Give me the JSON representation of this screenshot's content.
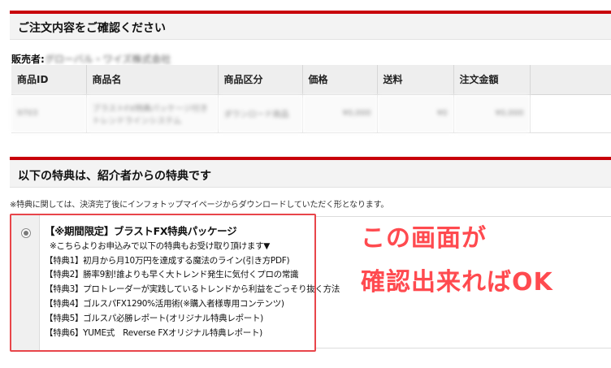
{
  "section1": {
    "title": "ご注文内容をご確認ください"
  },
  "seller": {
    "label": "販売者:",
    "name": "グローバル・ワイズ株式会社"
  },
  "order_table": {
    "headers": [
      "商品ID",
      "商品名",
      "商品区分",
      "価格",
      "送料",
      "注文金額"
    ],
    "row": [
      "9703",
      "ブラストFX特典パッケージ付き トレンドラインシステム",
      "ダウンロード商品",
      "¥0,000",
      "¥0",
      "¥0,000"
    ]
  },
  "section2": {
    "title": "以下の特典は、紹介者からの特典です"
  },
  "note": "※特典に関しては、決済完了後にインフォトップマイページからダウンロードしていただく形となります。",
  "bonus": {
    "title": "【※期間限定】ブラストFX特典パッケージ",
    "lines": [
      "※こちらよりお申込みで以下の特典もお受け取り頂けます▼",
      "【特典1】初月から月10万円を達成する魔法のライン(引き方PDF)",
      "【特典2】勝率9割!誰よりも早く大トレンド発生に気付くプロの常識",
      "【特典3】プロトレーダーが実践しているトレンドから利益をごっそり抜く方法",
      "【特典4】ゴルスパFX1290%活用術(※購入者様専用コンテンツ)",
      "【特典5】ゴルスパ必勝レポート(オリジナル特典レポート)",
      "【特典6】YUME式　Reverse FXオリジナル特典レポート)"
    ]
  },
  "annotation": {
    "line1": "この画面が",
    "line2": "確認出来ればOK",
    "color": "#ff4a4f"
  },
  "colors": {
    "accent_red": "#c8000a",
    "frame_red": "#e8454a"
  }
}
